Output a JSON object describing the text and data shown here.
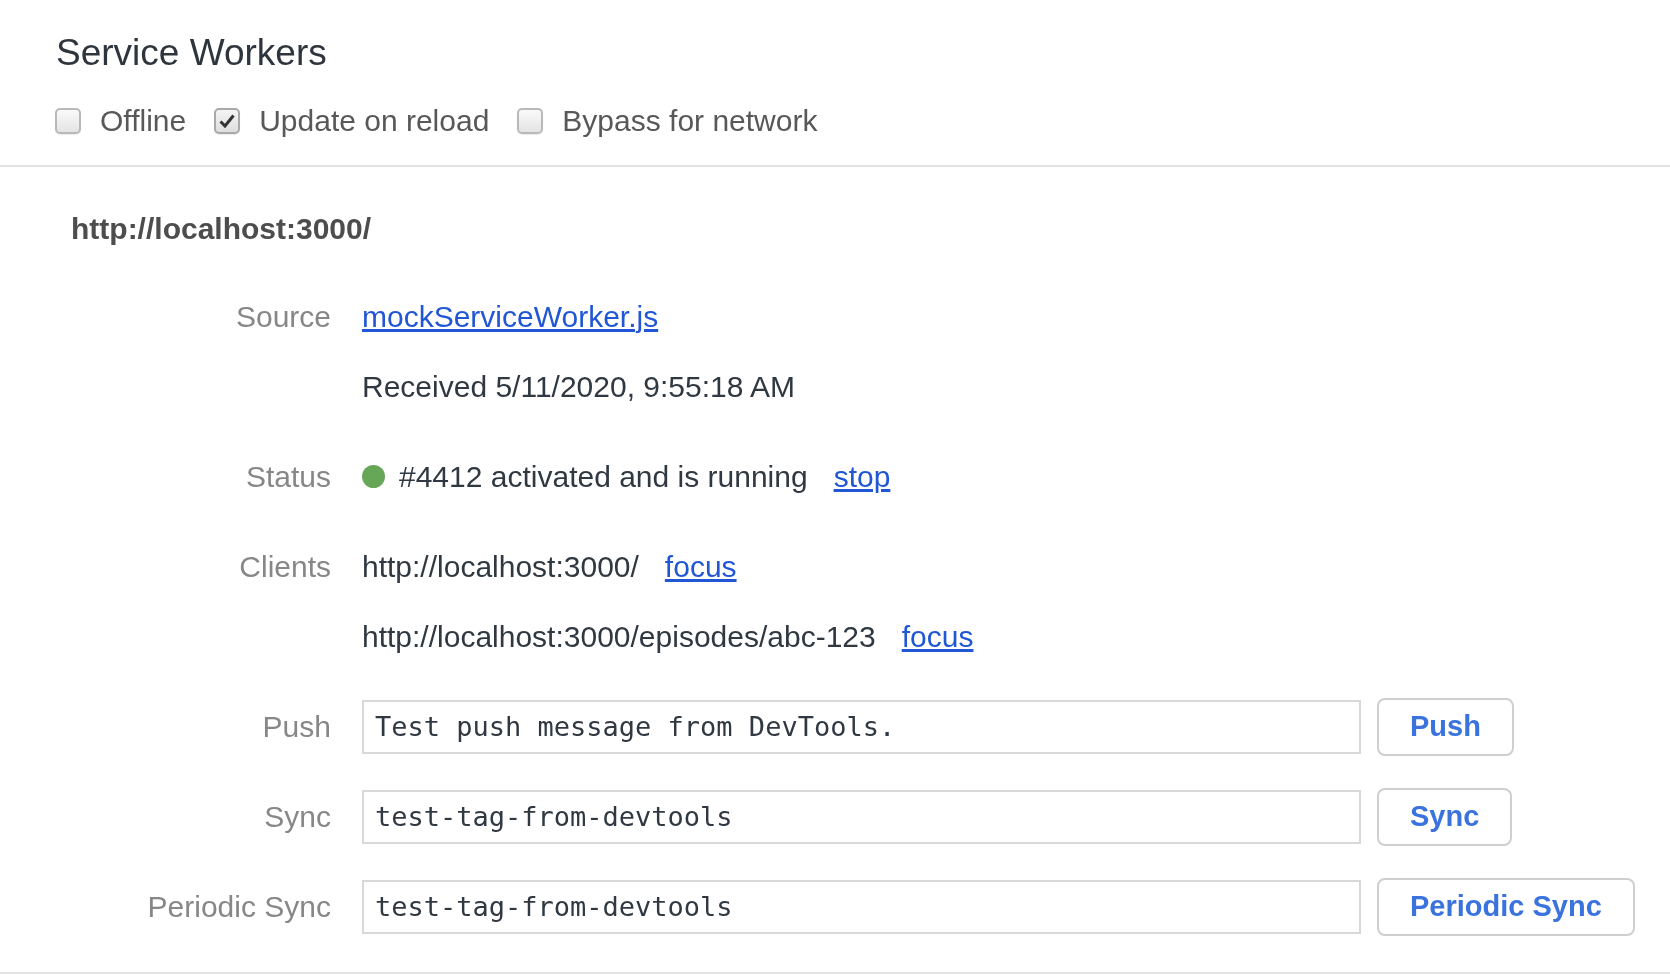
{
  "title": "Service Workers",
  "options": [
    {
      "label": "Offline",
      "checked": false
    },
    {
      "label": "Update on reload",
      "checked": true
    },
    {
      "label": "Bypass for network",
      "checked": false
    }
  ],
  "worker": {
    "scope": "http://localhost:3000/",
    "fields": [
      {
        "kind": "source",
        "label": "Source",
        "file": "mockServiceWorker.js",
        "received": "Received 5/11/2020, 9:55:18 AM"
      },
      {
        "kind": "status",
        "label": "Status",
        "color": "#66a657",
        "text": "#4412 activated and is running",
        "action": "stop"
      },
      {
        "kind": "clients",
        "label": "Clients",
        "clients": [
          {
            "url": "http://localhost:3000/",
            "action": "focus"
          },
          {
            "url": "http://localhost:3000/episodes/abc-123",
            "action": "focus"
          }
        ]
      },
      {
        "kind": "input",
        "label": "Push",
        "value": "Test push message from DevTools.",
        "button": "Push"
      },
      {
        "kind": "input",
        "label": "Sync",
        "value": "test-tag-from-devtools",
        "button": "Sync"
      },
      {
        "kind": "input",
        "label": "Periodic Sync",
        "value": "test-tag-from-devtools",
        "button": "Periodic Sync"
      }
    ]
  }
}
